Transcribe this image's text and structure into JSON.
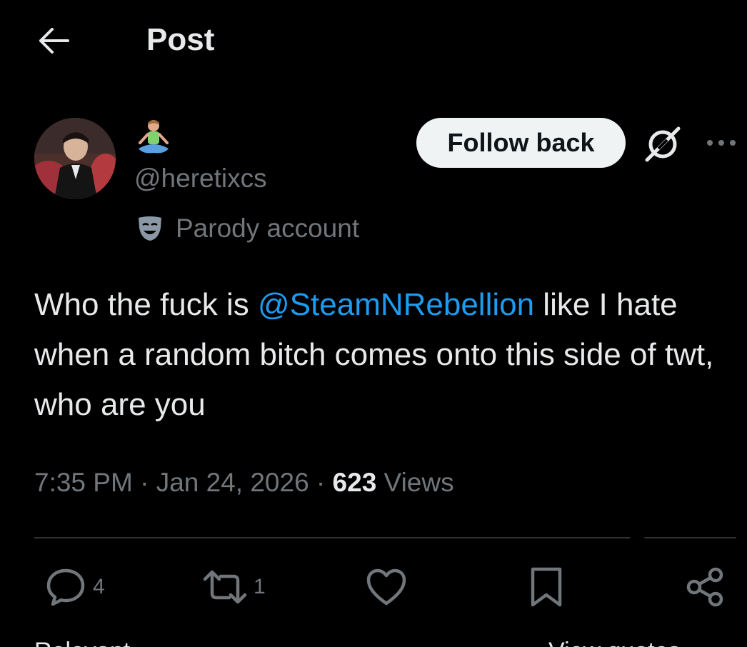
{
  "header": {
    "title": "Post"
  },
  "author": {
    "display_name_emoji": "🧘🏼",
    "handle": "@heretixcs",
    "label": "Parody account"
  },
  "actions": {
    "follow_label": "Follow back"
  },
  "tweet": {
    "text_before": "Who the fuck is ",
    "mention": "@SteamNRebellion",
    "text_after": " like I hate when a random bitch comes onto this side of twt, who are you"
  },
  "meta": {
    "time": "7:35 PM",
    "separator": " · ",
    "date": "Jan 24, 2026",
    "views_count": "623",
    "views_label": " Views"
  },
  "engagement": {
    "replies": "4",
    "reposts": "1"
  },
  "footer_cut": {
    "left_text": "Relevant",
    "right_text": "View quotes"
  },
  "colors": {
    "background": "#000000",
    "text_primary": "#e7e9ea",
    "text_secondary": "#71767b",
    "link": "#1d9bf0",
    "divider": "#2f3336",
    "follow_bg": "#eff3f4"
  }
}
